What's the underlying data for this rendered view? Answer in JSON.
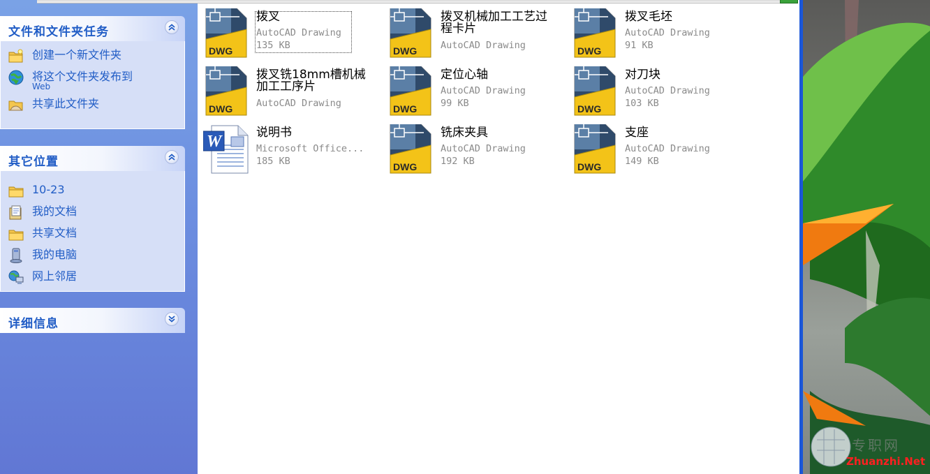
{
  "task_pane": {
    "file_tasks": {
      "title": "文件和文件夹任务",
      "items": [
        {
          "label": "创建一个新文件夹",
          "sub": "",
          "icon": "new-folder-icon"
        },
        {
          "label": "将这个文件夹发布到",
          "sub": "Web",
          "icon": "publish-web-icon"
        },
        {
          "label": "共享此文件夹",
          "sub": "",
          "icon": "share-folder-icon"
        }
      ]
    },
    "other_places": {
      "title": "其它位置",
      "items": [
        {
          "label": "10-23",
          "icon": "folder-icon"
        },
        {
          "label": "我的文档",
          "icon": "my-documents-icon"
        },
        {
          "label": "共享文档",
          "icon": "shared-folder-icon"
        },
        {
          "label": "我的电脑",
          "icon": "my-computer-icon"
        },
        {
          "label": "网上邻居",
          "icon": "network-places-icon"
        }
      ]
    },
    "details": {
      "title": "详细信息"
    }
  },
  "files": [
    {
      "name": "拨叉",
      "type": "AutoCAD Drawing",
      "size": "135 KB",
      "icon": "dwg-file-icon",
      "focused": true
    },
    {
      "name": "拨叉机械加工工艺过程卡片",
      "type": "AutoCAD Drawing",
      "size": "",
      "icon": "dwg-file-icon"
    },
    {
      "name": "拨叉毛坯",
      "type": "AutoCAD Drawing",
      "size": "91 KB",
      "icon": "dwg-file-icon"
    },
    {
      "name": "拨叉铣18mm槽机械加工工序片",
      "type": "AutoCAD Drawing",
      "size": "",
      "icon": "dwg-file-icon"
    },
    {
      "name": "定位心轴",
      "type": "AutoCAD Drawing",
      "size": "99 KB",
      "icon": "dwg-file-icon"
    },
    {
      "name": "对刀块",
      "type": "AutoCAD Drawing",
      "size": "103 KB",
      "icon": "dwg-file-icon"
    },
    {
      "name": "说明书",
      "type": "Microsoft Office...",
      "size": "185 KB",
      "icon": "word-document-icon"
    },
    {
      "name": "铣床夹具",
      "type": "AutoCAD Drawing",
      "size": "192 KB",
      "icon": "dwg-file-icon"
    },
    {
      "name": "支座",
      "type": "AutoCAD Drawing",
      "size": "149 KB",
      "icon": "dwg-file-icon"
    }
  ],
  "dwg_badge": "DWG",
  "word_badge": "W",
  "watermark": {
    "text": "Zhuanzhi.Net",
    "logo_text": "专职网"
  },
  "colors": {
    "accent": "#215dc6",
    "taskpane": "#6f92e0",
    "panel_body": "#d6dff7",
    "dwg_yellow": "#f3c318"
  }
}
